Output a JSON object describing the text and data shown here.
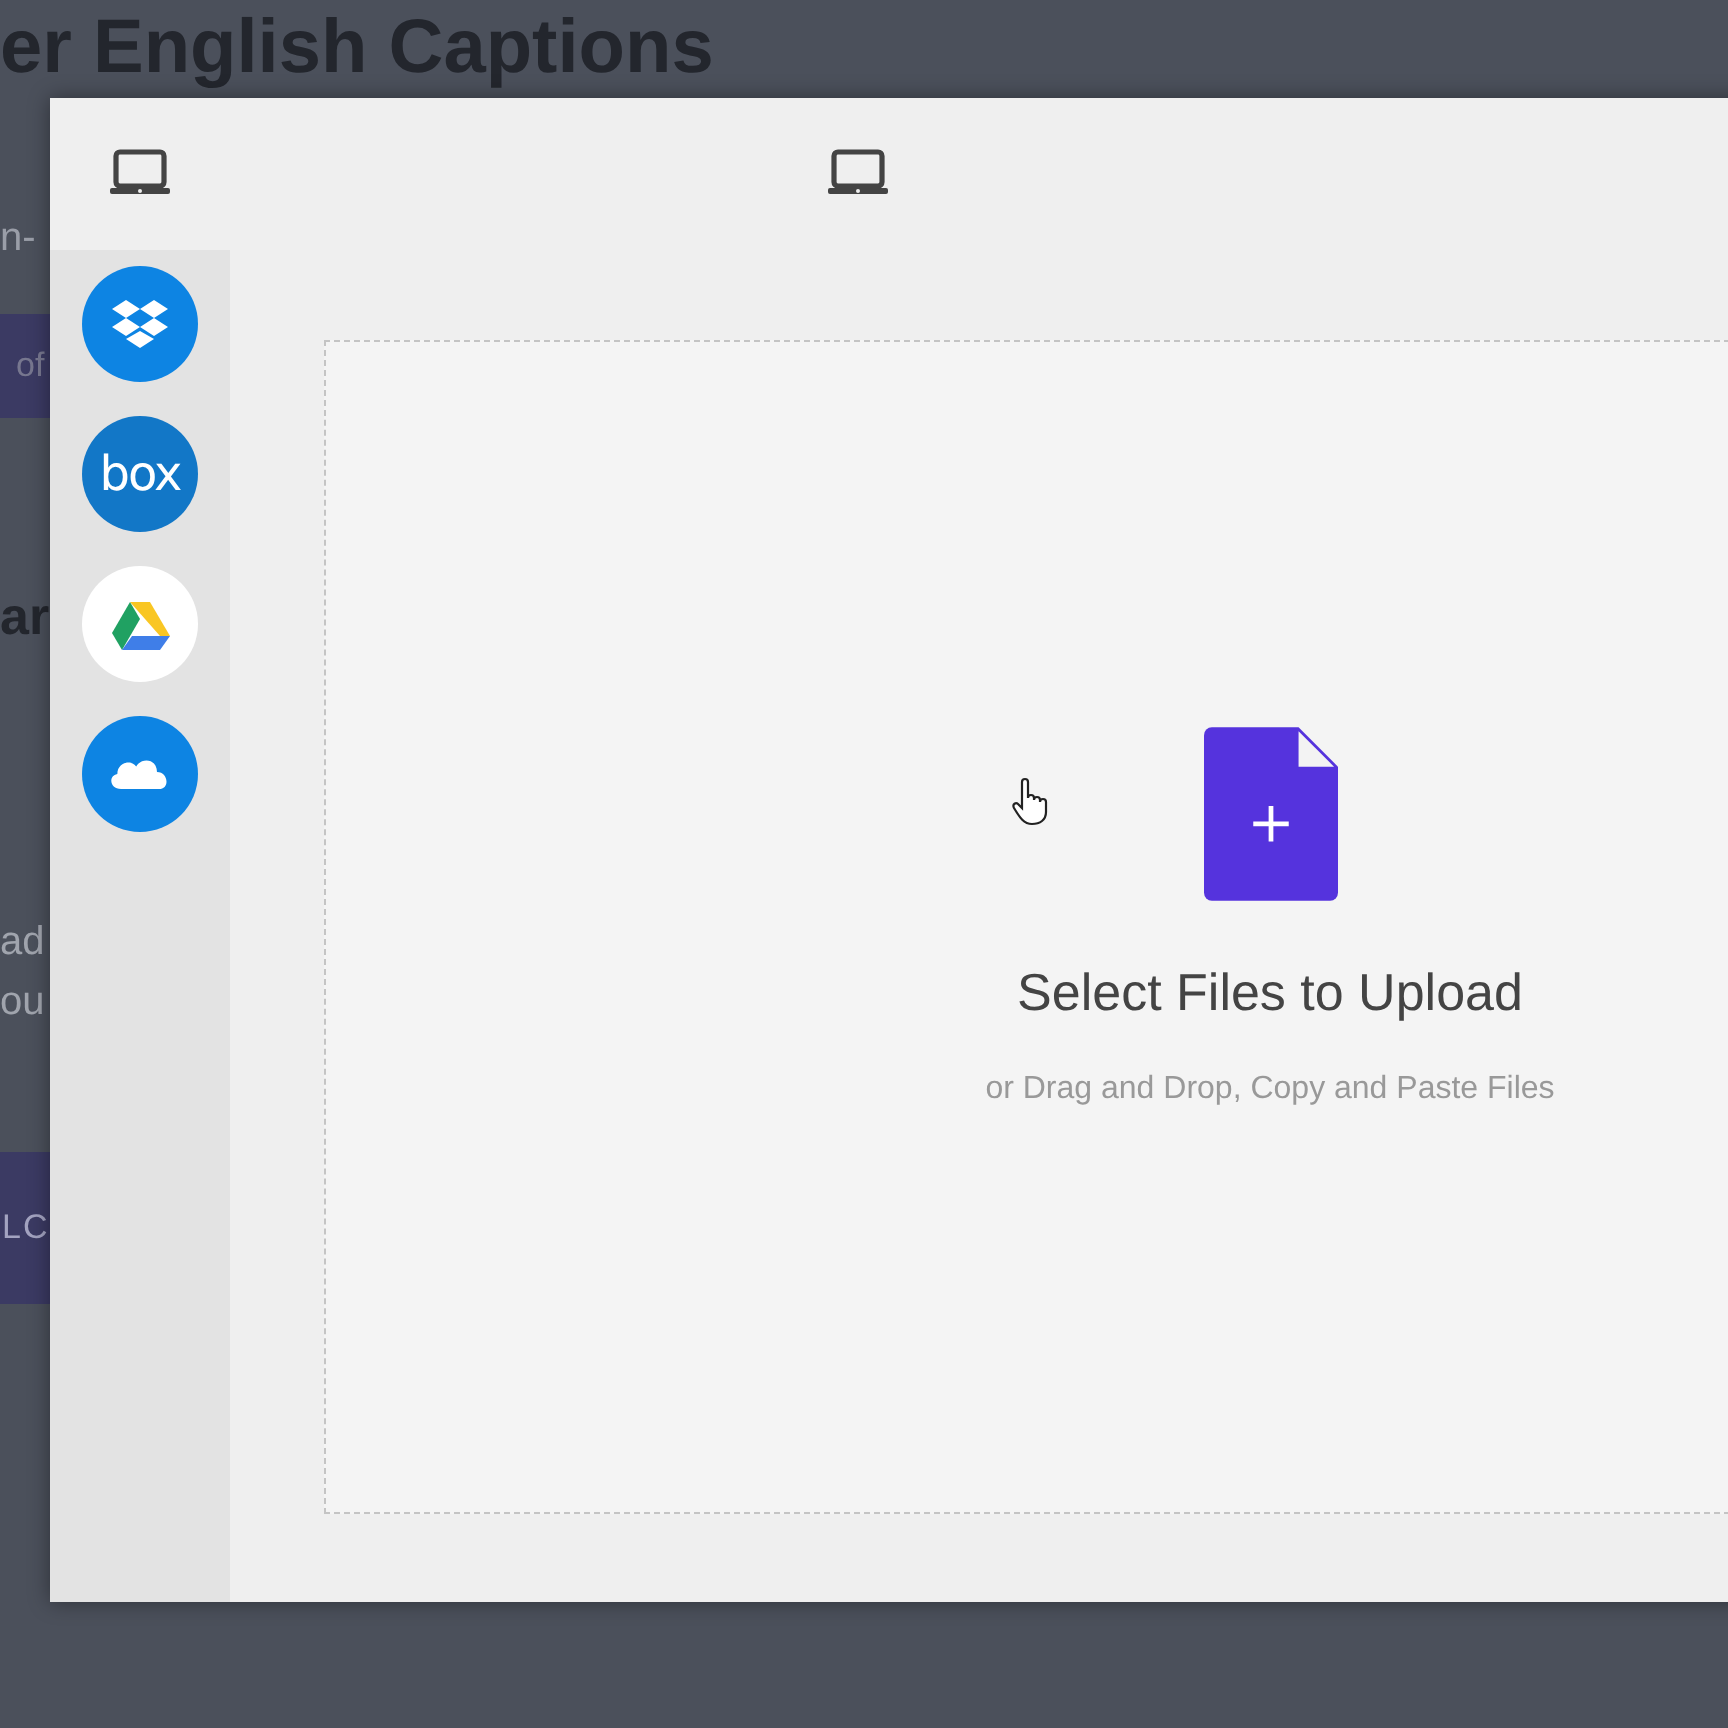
{
  "background_page": {
    "heading": "er English Captions",
    "subtitle": "n-",
    "banner_text": "of",
    "section_heading": "ar",
    "paragraph_lines": [
      "ad",
      "ou"
    ],
    "button": "LC"
  },
  "upload_dialog": {
    "sources": [
      {
        "kind": "dropbox"
      },
      {
        "kind": "box",
        "label": "box"
      },
      {
        "kind": "drive"
      },
      {
        "kind": "onedrive"
      }
    ],
    "dropzone": {
      "title": "Select Files to Upload",
      "subtitle": "or Drag and Drop, Copy and Paste Files"
    }
  }
}
